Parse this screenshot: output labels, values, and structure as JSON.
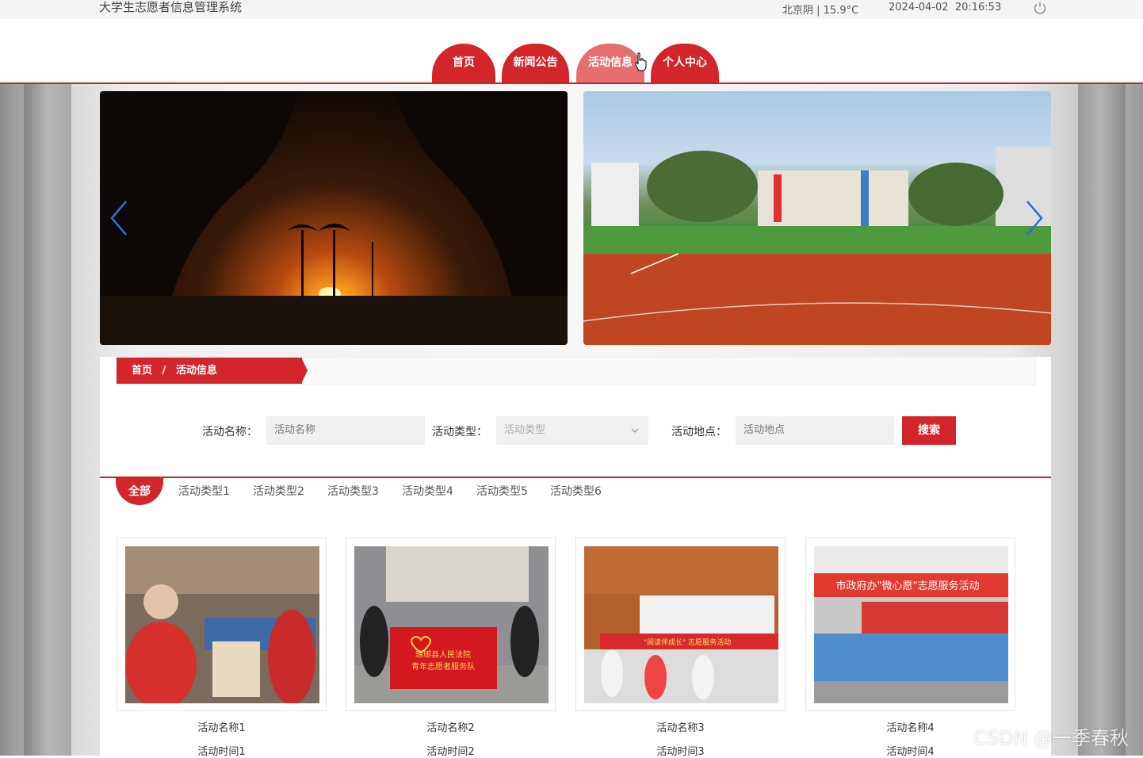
{
  "header": {
    "site_title": "大学生志愿者信息管理系统",
    "weather": "北京阴 | 15.9°C",
    "date": "2024-04-02",
    "time": "20:16:53",
    "power_icon": "power-icon"
  },
  "nav": {
    "items": [
      {
        "label": "首页"
      },
      {
        "label": "新闻公告"
      },
      {
        "label": "活动信息",
        "active": true
      },
      {
        "label": "个人中心"
      }
    ]
  },
  "carousel": {
    "prev_icon": "chevron-left-icon",
    "next_icon": "chevron-right-icon",
    "slides": [
      "sunset-photo",
      "school-playground-photo"
    ]
  },
  "breadcrumb": {
    "home": "首页",
    "separator": "/",
    "current": "活动信息"
  },
  "search": {
    "name_label": "活动名称：",
    "name_placeholder": "活动名称",
    "type_label": "活动类型：",
    "type_placeholder": "活动类型",
    "location_label": "活动地点：",
    "location_placeholder": "活动地点",
    "button": "搜索"
  },
  "category_tabs": [
    "全部",
    "活动类型1",
    "活动类型2",
    "活动类型3",
    "活动类型4",
    "活动类型5",
    "活动类型6"
  ],
  "activities": [
    {
      "name": "活动名称1",
      "time": "活动时间1"
    },
    {
      "name": "活动名称2",
      "time": "活动时间2"
    },
    {
      "name": "活动名称3",
      "time": "活动时间3"
    },
    {
      "name": "活动名称4",
      "time": "活动时间4"
    }
  ],
  "photo_captions": {
    "card2_banner_line1": "琅琊县人民法院",
    "card2_banner_line2": "青年志愿者服务队",
    "card3_banner": "\"阅读伴成长\" 志愿服务活动",
    "card4_banner": "市政府办\"微心愿\"志愿服务活动"
  },
  "watermark": "CSDN @一季春秋",
  "colors": {
    "brand_red": "#d2252c",
    "active_nav": "#e36f6f"
  }
}
